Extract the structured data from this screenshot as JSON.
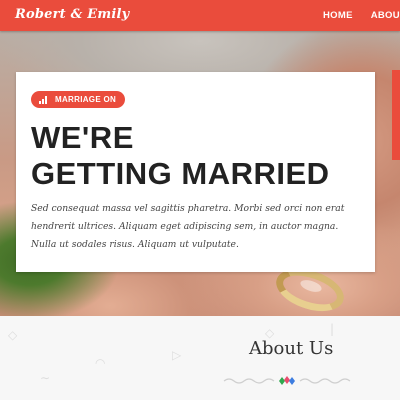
{
  "header": {
    "brand": "Robert & Emily",
    "nav": [
      {
        "label": "HOME"
      },
      {
        "label": "ABOUT"
      }
    ]
  },
  "hero": {
    "badge": {
      "label": "MARRIAGE ON",
      "icon": "signal-bars-icon"
    },
    "headline_line1": "WE'RE",
    "headline_line2": "GETTING MARRIED",
    "description": "Sed consequat massa vel sagittis pharetra. Morbi sed orci non erat hendrerit ultrices. Aliquam eget adipiscing sem, in auctor magna. Nulla ut sodales risus. Aliquam ut vulputate."
  },
  "about": {
    "title": "About Us"
  },
  "colors": {
    "accent": "#ea4c3c",
    "heading": "#222222",
    "text": "#444444",
    "section_bg": "#f7f7f7"
  }
}
